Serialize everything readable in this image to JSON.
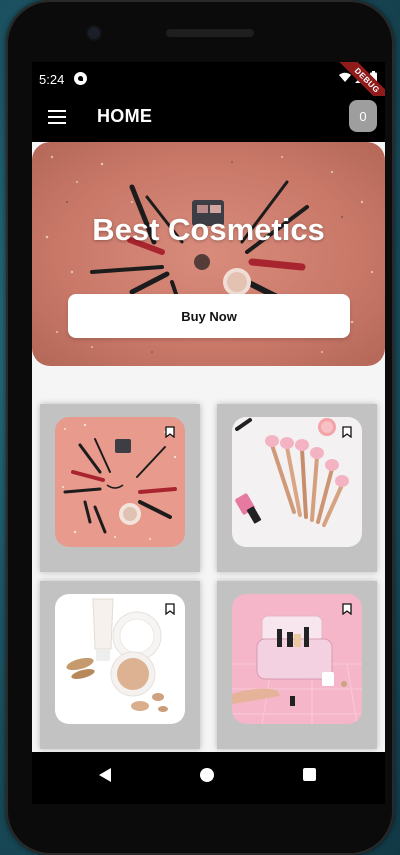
{
  "status_bar": {
    "time": "5:24",
    "debug_label": "DEBUG"
  },
  "app_bar": {
    "title": "HOME",
    "cart_count": "0"
  },
  "hero": {
    "title": "Best Cosmetics",
    "button_label": "Buy Now"
  },
  "products": [
    {
      "image": "makeup-flatlay-pink"
    },
    {
      "image": "rose-gold-brushes"
    },
    {
      "image": "foundation-compact-cream"
    },
    {
      "image": "cosmetic-bag-pink"
    }
  ],
  "colors": {
    "accent": "#000000",
    "card_bg": "#c2c2c2",
    "hero_bg": "#c97868",
    "badge": "#9e9e9e"
  }
}
